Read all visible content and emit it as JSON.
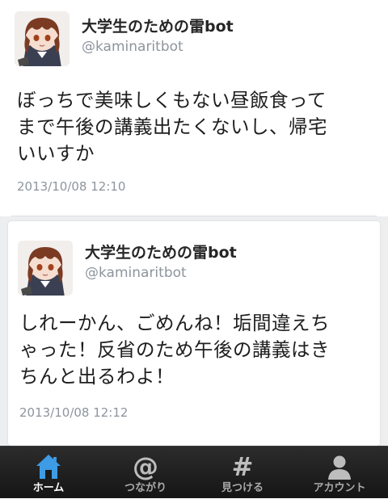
{
  "tweets": [
    {
      "display_name": "大学生のための雷bot",
      "handle": "@kaminaritbot",
      "lines": [
        "ぼっちで美味しくもない昼飯食って",
        "まで午後の講義出たくないし、帰宅",
        "いいすか"
      ],
      "timestamp": "2013/10/08 12:10"
    },
    {
      "display_name": "大学生のための雷bot",
      "handle": "@kaminaritbot",
      "lines": [
        "しれーかん、ごめんね！垢間違えち",
        "ゃった！反省のため午後の講義はき",
        "ちんと出るわよ！"
      ],
      "timestamp": "2013/10/08 12:12"
    }
  ],
  "tabbar": {
    "tabs": [
      {
        "label": "ホーム",
        "icon": "home-icon",
        "active": true
      },
      {
        "label": "つながり",
        "icon": "at-icon",
        "active": false
      },
      {
        "label": "見つける",
        "icon": "hash-icon",
        "active": false
      },
      {
        "label": "アカウント",
        "icon": "person-icon",
        "active": false
      }
    ]
  },
  "colors": {
    "active_tab": "#ffffff",
    "home_icon": "#3e9be5",
    "muted_text": "#8d959c",
    "tabbar": "#1c1c1c"
  }
}
